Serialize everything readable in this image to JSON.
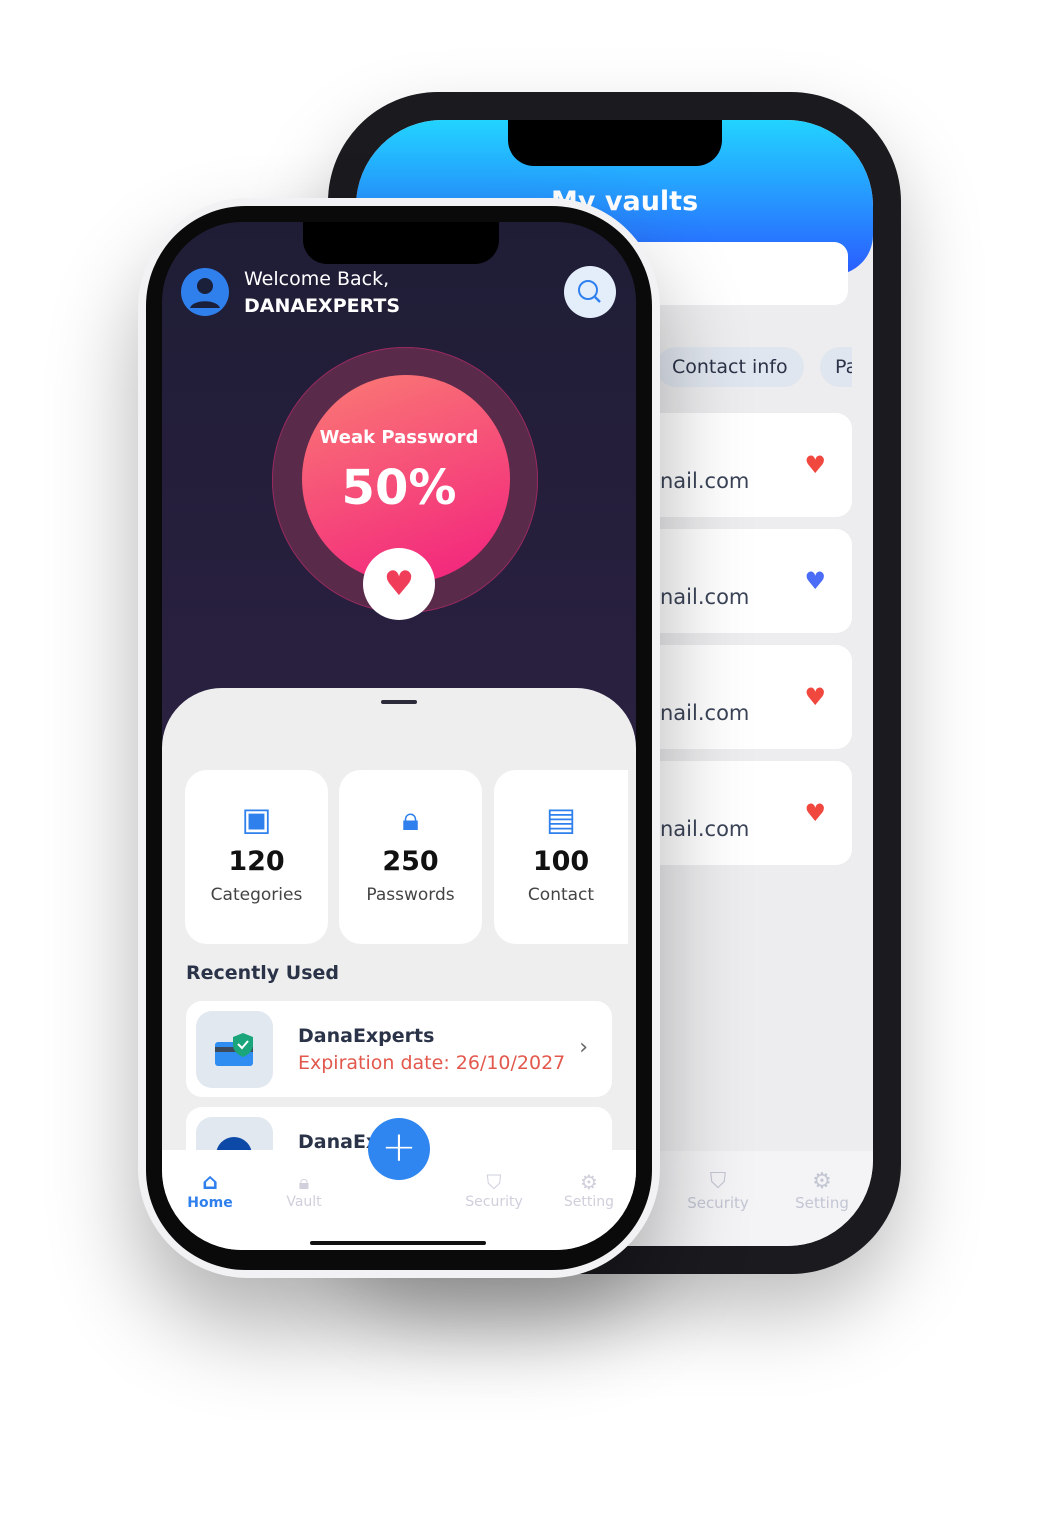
{
  "back_phone": {
    "title": "My vaults",
    "chips": [
      "Contact info",
      "Pa"
    ],
    "cards": [
      {
        "text": "nail.com",
        "heart_color": "#f0473f"
      },
      {
        "text": "nail.com",
        "heart_color": "#4a6cf7"
      },
      {
        "text": "nail.com",
        "heart_color": "#f0473f"
      },
      {
        "text": "nail.com",
        "heart_color": "#f0473f"
      }
    ],
    "nav": [
      "Security",
      "Setting"
    ]
  },
  "front_phone": {
    "welcome": "Welcome Back,",
    "username": "DANAEXPERTS",
    "gauge": {
      "label": "Weak Password",
      "value": "50%",
      "percent": 50
    },
    "stats": [
      {
        "value": "120",
        "label": "Categories",
        "icon": "grid-icon"
      },
      {
        "value": "250",
        "label": "Passwords",
        "icon": "lock-icon"
      },
      {
        "value": "100",
        "label": "Contact",
        "icon": "contact-book-icon"
      }
    ],
    "recent_title": "Recently Used",
    "recent": [
      {
        "name": "DanaExperts",
        "expiration": "Expiration date: 26/10/2027"
      },
      {
        "name": "DanaEx"
      }
    ],
    "nav": {
      "home": "Home",
      "vault": "Vault",
      "security": "Security",
      "setting": "Setting"
    },
    "accent": "#2f80ed"
  }
}
